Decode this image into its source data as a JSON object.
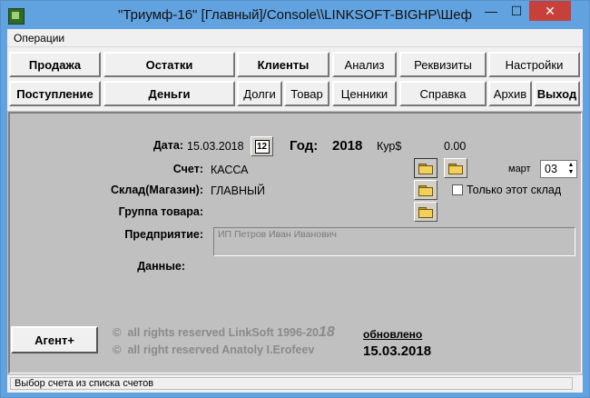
{
  "window": {
    "title": "\"Триумф-16\" [Главный]/Console\\\\LINKSOFT-BIGHP\\Шеф"
  },
  "controls": {
    "minimize": "—",
    "maximize": "☐",
    "close": "✕"
  },
  "menubar": {
    "operations": "Операции"
  },
  "toolbar": {
    "row1": [
      "Продажа",
      "Остатки",
      "Клиенты",
      "Анализ",
      "Реквизиты",
      "Настройки"
    ],
    "row2": [
      "Поступление",
      "Деньги",
      "Долги",
      "Товар",
      "Ценники",
      "Справка",
      "Архив",
      "Выход"
    ]
  },
  "form": {
    "date_label": "Дата:",
    "date_value": "15.03.2018",
    "calendar_icon_text": "12",
    "year_label": "Год:",
    "year_value": "2018",
    "rate_label": "Кур$",
    "rate_value": "0.00",
    "account_label": "Счет:",
    "account_value": "КАССА",
    "month_label": "март",
    "month_spinner_value": "03",
    "warehouse_label": "Склад(Магазин):",
    "warehouse_value": "ГЛАВНЫЙ",
    "only_this_warehouse": "Только этот склад",
    "group_label": "Группа товара:",
    "enterprise_label": "Предприятие:",
    "enterprise_value": "ИП Петров Иван Иванович",
    "data_label": "Данные:"
  },
  "footer": {
    "agent_button": "Агент+",
    "copyright1_prefix": "all rights reserved LinkSoft 1996-20",
    "copyright1_year": "18",
    "copyright2": "all right reserved Anatoly I.Erofeev",
    "updated_label": "обновлено",
    "updated_date": "15.03.2018",
    "copyright_symbol": "©"
  },
  "status": {
    "text": "Выбор счета из списка счетов"
  }
}
